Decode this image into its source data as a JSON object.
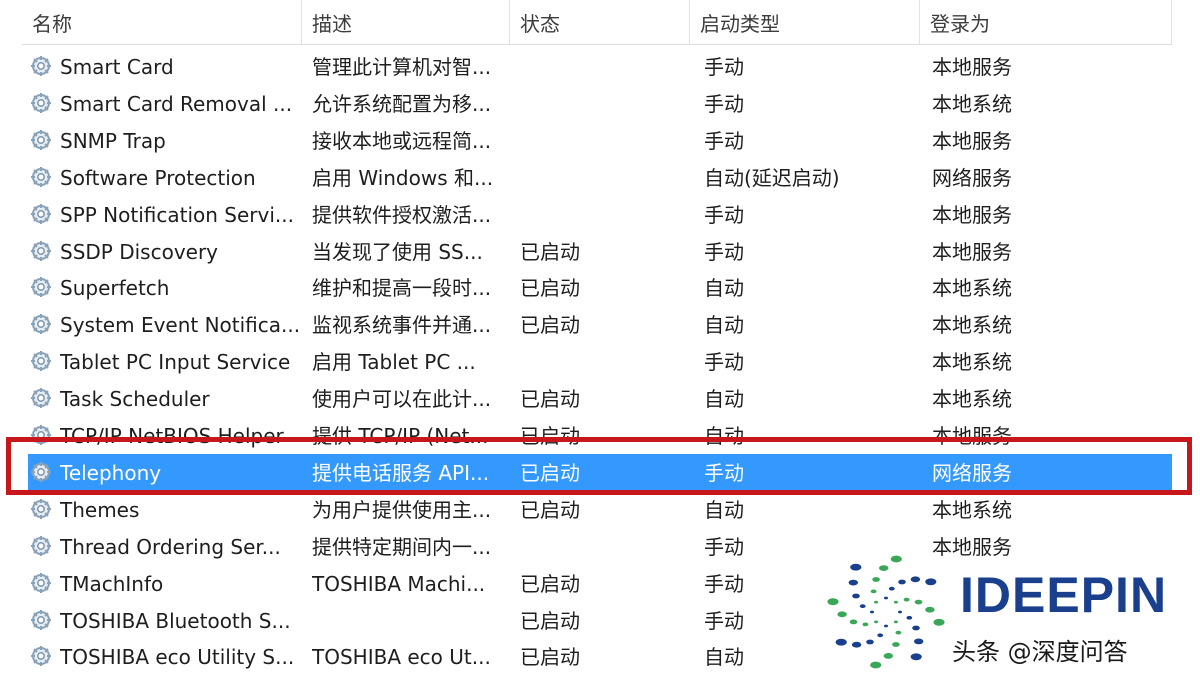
{
  "columns": {
    "name": "名称",
    "description": "描述",
    "status": "状态",
    "startup_type": "启动类型",
    "logon_as": "登录为"
  },
  "services": [
    {
      "name": "Smart Card",
      "description": "管理此计算机对智...",
      "status": "",
      "startup_type": "手动",
      "logon_as": "本地服务"
    },
    {
      "name": "Smart Card Removal ...",
      "description": "允许系统配置为移...",
      "status": "",
      "startup_type": "手动",
      "logon_as": "本地系统"
    },
    {
      "name": "SNMP Trap",
      "description": "接收本地或远程简...",
      "status": "",
      "startup_type": "手动",
      "logon_as": "本地服务"
    },
    {
      "name": "Software Protection",
      "description": "启用 Windows 和...",
      "status": "",
      "startup_type": "自动(延迟启动)",
      "logon_as": "网络服务"
    },
    {
      "name": "SPP Notification Servi...",
      "description": "提供软件授权激活...",
      "status": "",
      "startup_type": "手动",
      "logon_as": "本地服务"
    },
    {
      "name": "SSDP Discovery",
      "description": "当发现了使用 SS...",
      "status": "已启动",
      "startup_type": "手动",
      "logon_as": "本地服务"
    },
    {
      "name": "Superfetch",
      "description": "维护和提高一段时...",
      "status": "已启动",
      "startup_type": "自动",
      "logon_as": "本地系统"
    },
    {
      "name": "System Event Notifica...",
      "description": "监视系统事件并通...",
      "status": "已启动",
      "startup_type": "自动",
      "logon_as": "本地系统"
    },
    {
      "name": "Tablet PC Input Service",
      "description": "启用 Tablet PC ...",
      "status": "",
      "startup_type": "手动",
      "logon_as": "本地系统"
    },
    {
      "name": "Task Scheduler",
      "description": "使用户可以在此计...",
      "status": "已启动",
      "startup_type": "自动",
      "logon_as": "本地系统"
    },
    {
      "name": "TCP/IP NetBIOS Helper",
      "description": "提供 TCP/IP (Net...",
      "status": "已启动",
      "startup_type": "自动",
      "logon_as": "本地服务"
    },
    {
      "name": "Telephony",
      "description": "提供电话服务 API...",
      "status": "已启动",
      "startup_type": "手动",
      "logon_as": "网络服务",
      "selected": true
    },
    {
      "name": "Themes",
      "description": "为用户提供使用主...",
      "status": "已启动",
      "startup_type": "自动",
      "logon_as": "本地系统"
    },
    {
      "name": "Thread Ordering Ser...",
      "description": "提供特定期间内一...",
      "status": "",
      "startup_type": "手动",
      "logon_as": "本地服务"
    },
    {
      "name": "TMachInfo",
      "description": "TOSHIBA Machi...",
      "status": "已启动",
      "startup_type": "手动",
      "logon_as": ""
    },
    {
      "name": "TOSHIBA Bluetooth S...",
      "description": "",
      "status": "已启动",
      "startup_type": "手动",
      "logon_as": ""
    },
    {
      "name": "TOSHIBA eco Utility S...",
      "description": "TOSHIBA eco Ut...",
      "status": "已启动",
      "startup_type": "自动",
      "logon_as": ""
    }
  ],
  "watermark": {
    "brand": "IDEEPIN",
    "sub": "头条 @深度问答"
  },
  "colors": {
    "selection": "#3399ff",
    "highlight_border": "#c8161d",
    "logo_blue": "#1a3f8c",
    "logo_green": "#3aa657"
  }
}
